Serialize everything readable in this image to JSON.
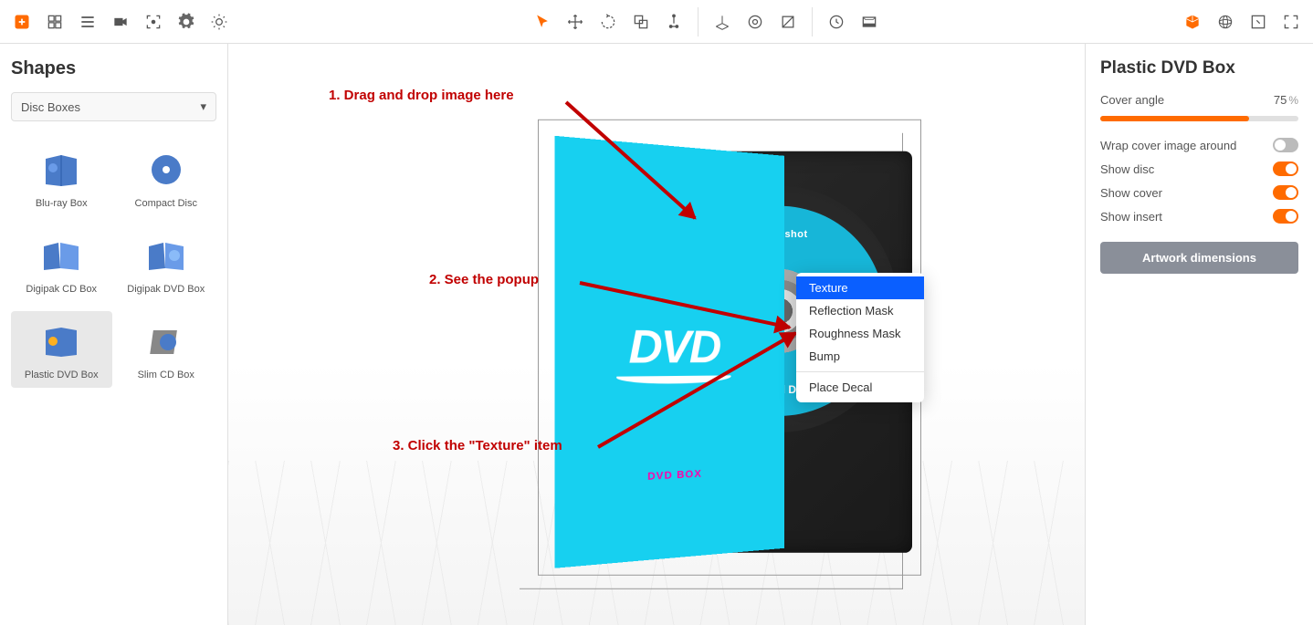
{
  "left": {
    "title": "Shapes",
    "category": "Disc Boxes",
    "shapes": [
      {
        "label": "Blu-ray Box"
      },
      {
        "label": "Compact Disc"
      },
      {
        "label": "Digipak CD Box"
      },
      {
        "label": "Digipak DVD Box"
      },
      {
        "label": "Plastic DVD Box"
      },
      {
        "label": "Slim CD Box"
      }
    ],
    "selected_index": 4
  },
  "viewport": {
    "cover_logo": "DVD",
    "cover_tag": "DVD BOX",
    "disc_brand": "⦿ boxshot",
    "disc_label": "Optical Disc",
    "annotations": [
      "1. Drag and drop image here",
      "2. See the popup",
      "3. Click the \"Texture\" item"
    ],
    "context_menu": {
      "items": [
        "Texture",
        "Reflection Mask",
        "Roughness Mask",
        "Bump"
      ],
      "extra": "Place Decal",
      "highlight_index": 0
    }
  },
  "right": {
    "title": "Plastic DVD Box",
    "cover_angle_label": "Cover angle",
    "cover_angle_value": "75",
    "cover_angle_unit": "%",
    "toggles": [
      {
        "label": "Wrap cover image around",
        "on": false
      },
      {
        "label": "Show disc",
        "on": true
      },
      {
        "label": "Show cover",
        "on": true
      },
      {
        "label": "Show insert",
        "on": true
      }
    ],
    "dimensions_btn": "Artwork dimensions"
  },
  "colors": {
    "accent": "#ff6b00",
    "annotation": "#c10000"
  }
}
